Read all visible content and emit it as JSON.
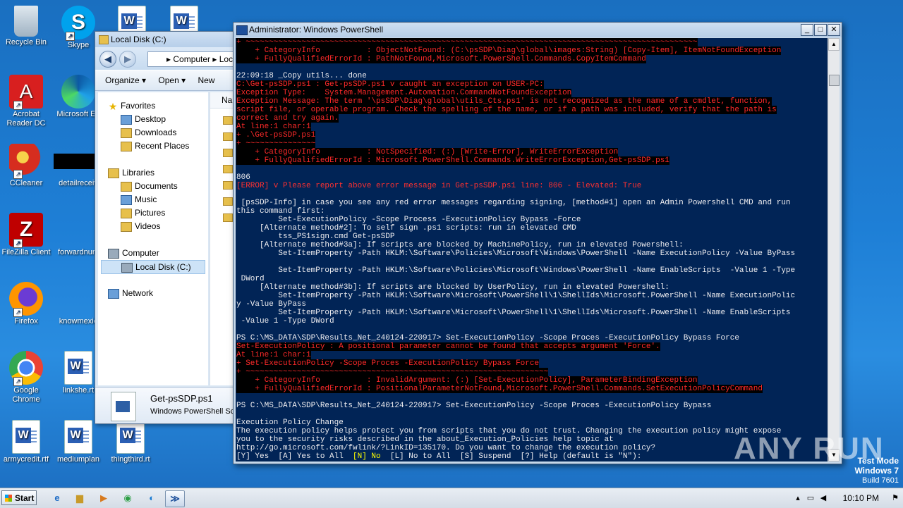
{
  "desktop": {
    "icons": [
      {
        "label": "Recycle Bin"
      },
      {
        "label": "Skype"
      },
      {
        "label": "Acrobat Reader DC"
      },
      {
        "label": "Microsoft Ed"
      },
      {
        "label": "CCleaner"
      },
      {
        "label": "detailreceiv"
      },
      {
        "label": "FileZilla Client"
      },
      {
        "label": "forwardnum"
      },
      {
        "label": "Firefox"
      },
      {
        "label": "knowmexic"
      },
      {
        "label": "Google Chrome"
      },
      {
        "label": "linkshe.rt"
      },
      {
        "label": "armycredit.rtf"
      },
      {
        "label": "mediumplan"
      },
      {
        "label": "thingthird.rt"
      }
    ]
  },
  "explorer": {
    "title": "Local Disk (C:)",
    "address_prefix": "▸ Computer ▸ Loca",
    "toolbar": {
      "organize": "Organize ▾",
      "open": "Open ▾",
      "new": "New"
    },
    "nav": {
      "favorites": "Favorites",
      "desktop": "Desktop",
      "downloads": "Downloads",
      "recent": "Recent Places",
      "libraries": "Libraries",
      "documents": "Documents",
      "music": "Music",
      "pictures": "Pictures",
      "videos": "Videos",
      "computer": "Computer",
      "local_disk": "Local Disk (C:)",
      "network": "Network"
    },
    "column_header": "Nar",
    "details": {
      "name": "Get-psSDP.ps1",
      "type": "Windows PowerShell Scr"
    }
  },
  "powershell": {
    "title": "Administrator: Windows PowerShell",
    "lines": [
      {
        "t": "+ ~~~~~~~~~~~~~~~~~~~~~~~~~~~~~~~~~~~~~~~~~~~~~~~~~~~~~~~~~~~~~~~~~~~~~~~~~~~~~~~~~~~~~~~~~~~~~~~~~",
        "k": "err"
      },
      {
        "t": "    + CategoryInfo          : ObjectNotFound: (C:\\psSDP\\Diag\\global\\images:String) [Copy-Item], ItemNotFoundException",
        "k": "err"
      },
      {
        "t": "    + FullyQualifiedErrorId : PathNotFound,Microsoft.PowerShell.Commands.CopyItemCommand",
        "k": "err"
      },
      {
        "t": "",
        "k": "n"
      },
      {
        "t": "22:09:18 _Copy utils... done",
        "k": "n"
      },
      {
        "t": "C:\\Get-psSDP.ps1 : Get-psSDP.ps1 v caught an exception on USER-PC:",
        "k": "err"
      },
      {
        "t": "Exception Type:    System.Management.Automation.CommandNotFoundException",
        "k": "err"
      },
      {
        "t": "Exception Message: The term '\\psSDP\\Diag\\global\\utils_Cts.ps1' is not recognized as the name of a cmdlet, function,",
        "k": "err"
      },
      {
        "t": "script file, or operable program. Check the spelling of the name, or if a path was included, verify that the path is",
        "k": "err"
      },
      {
        "t": "correct and try again.",
        "k": "err"
      },
      {
        "t": "At line:1 char:1",
        "k": "err"
      },
      {
        "t": "+ .\\Get-psSDP.ps1",
        "k": "err"
      },
      {
        "t": "+ ~~~~~~~~~~~~~~~",
        "k": "err"
      },
      {
        "t": "    + CategoryInfo          : NotSpecified: (:) [Write-Error], WriteErrorException",
        "k": "err"
      },
      {
        "t": "    + FullyQualifiedErrorId : Microsoft.PowerShell.Commands.WriteErrorException,Get-psSDP.ps1",
        "k": "err"
      },
      {
        "t": "",
        "k": "n"
      },
      {
        "t": "806",
        "k": "n"
      },
      {
        "t": "[ERROR] v Please report above error message in Get-psSDP.ps1 line: 806 - Elevated: True",
        "k": "warn"
      },
      {
        "t": "",
        "k": "n"
      },
      {
        "t": " [psSDP-Info] in case you see any red error messages regarding signing, [method#1] open an Admin Powershell CMD and run",
        "k": "n"
      },
      {
        "t": "this command first:",
        "k": "n"
      },
      {
        "t": "         Set-ExecutionPolicy -Scope Process -ExecutionPolicy Bypass -Force",
        "k": "n"
      },
      {
        "t": "     [Alternate method#2]: To self sign .ps1 scripts: run in elevated CMD",
        "k": "n"
      },
      {
        "t": "         tss_PS1sign.cmd Get-psSDP",
        "k": "n"
      },
      {
        "t": "     [Alternate method#3a]: If scripts are blocked by MachinePolicy, run in elevated Powershell:",
        "k": "n"
      },
      {
        "t": "         Set-ItemProperty -Path HKLM:\\Software\\Policies\\Microsoft\\Windows\\PowerShell -Name ExecutionPolicy -Value ByPass",
        "k": "n"
      },
      {
        "t": "",
        "k": "n"
      },
      {
        "t": "         Set-ItemProperty -Path HKLM:\\Software\\Policies\\Microsoft\\Windows\\PowerShell -Name EnableScripts  -Value 1 -Type",
        "k": "n"
      },
      {
        "t": " DWord",
        "k": "n"
      },
      {
        "t": "     [Alternate method#3b]: If scripts are blocked by UserPolicy, run in elevated Powershell:",
        "k": "n"
      },
      {
        "t": "         Set-ItemProperty -Path HKLM:\\Software\\Microsoft\\PowerShell\\1\\ShellIds\\Microsoft.PowerShell -Name ExecutionPolic",
        "k": "n"
      },
      {
        "t": "y -Value ByPass",
        "k": "n"
      },
      {
        "t": "         Set-ItemProperty -Path HKLM:\\Software\\Microsoft\\PowerShell\\1\\ShellIds\\Microsoft.PowerShell -Name EnableScripts",
        "k": "n"
      },
      {
        "t": " -Value 1 -Type DWord",
        "k": "n"
      },
      {
        "t": "",
        "k": "n"
      },
      {
        "t": "PS C:\\MS_DATA\\SDP\\Results_Net_240124-220917> Set-ExecutionPolicy -Scope Proces -ExecutionPolicy Bypass Force",
        "k": "n"
      },
      {
        "t": "Set-ExecutionPolicy : A positional parameter cannot be found that accepts argument 'Force'.",
        "k": "err"
      },
      {
        "t": "At line:1 char:1",
        "k": "err"
      },
      {
        "t": "+ Set-ExecutionPolicy -Scope Proces -ExecutionPolicy Bypass Force",
        "k": "err"
      },
      {
        "t": "+ ~~~~~~~~~~~~~~~~~~~~~~~~~~~~~~~~~~~~~~~~~~~~~~~~~~~~~~~~~~~~~~~~~",
        "k": "err"
      },
      {
        "t": "    + CategoryInfo          : InvalidArgument: (:) [Set-ExecutionPolicy], ParameterBindingException",
        "k": "err"
      },
      {
        "t": "    + FullyQualifiedErrorId : PositionalParameterNotFound,Microsoft.PowerShell.Commands.SetExecutionPolicyCommand",
        "k": "err"
      },
      {
        "t": "",
        "k": "n"
      },
      {
        "t": "PS C:\\MS_DATA\\SDP\\Results_Net_240124-220917> Set-ExecutionPolicy -Scope Proces -ExecutionPolicy Bypass",
        "k": "n"
      },
      {
        "t": "",
        "k": "n"
      },
      {
        "t": "Execution Policy Change",
        "k": "n"
      },
      {
        "t": "The execution policy helps protect you from scripts that you do not trust. Changing the execution policy might expose",
        "k": "n"
      },
      {
        "t": "you to the security risks described in the about_Execution_Policies help topic at",
        "k": "n"
      },
      {
        "t": "http://go.microsoft.com/fwlink/?LinkID=135170. Do you want to change the execution policy?",
        "k": "n"
      },
      {
        "t": "[Y] Yes  [A] Yes to All  [N] No  [L] No to All  [S] Suspend  [?] Help (default is \"N\"):",
        "k": "prompt"
      }
    ],
    "prompt_no": "[N] No",
    "colors": {
      "background": "#012456",
      "error_text": "#ff2a2a",
      "error_bg": "#000000",
      "prompt_highlight": "#ffff00"
    }
  },
  "watermark": {
    "text": "ANY RUN"
  },
  "build": {
    "line1": "Test Mode",
    "line2": "Windows 7",
    "line3": "Build 7601"
  },
  "taskbar": {
    "start": "Start",
    "apps": [
      "ie-icon",
      "explorer-icon",
      "media-player-icon",
      "chrome-icon",
      "edge-icon",
      "powershell-icon"
    ],
    "clock": "10:10 PM"
  }
}
